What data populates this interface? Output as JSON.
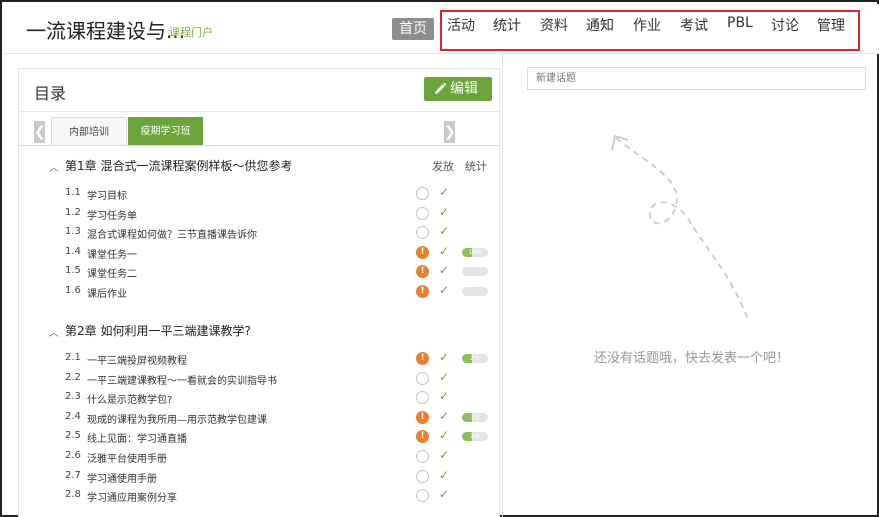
{
  "header": {
    "course_title": "一流课程建设与...",
    "portal_link": "课程门户",
    "home_label": "首页",
    "nav": [
      "活动",
      "统计",
      "资料",
      "通知",
      "作业",
      "考试",
      "PBL",
      "讨论",
      "管理"
    ]
  },
  "toc": {
    "title": "目录",
    "edit_label": "编辑",
    "prev_arrow": "❮",
    "next_arrow": "❯",
    "tabs": [
      "内部培训",
      "疫期学习班"
    ],
    "active_tab": "疫期学习班",
    "col_publish": "发放",
    "col_stats": "统计",
    "chapters": [
      {
        "title": "第1章 混合式一流课程案例样板～供您参考",
        "lessons": [
          {
            "num": "1.1",
            "name": "学习目标",
            "alert": false,
            "progress": null,
            "progress_label": ""
          },
          {
            "num": "1.2",
            "name": "学习任务单",
            "alert": false,
            "progress": null,
            "progress_label": ""
          },
          {
            "num": "1.3",
            "name": "混合式课程如何做？三节直播课告诉你",
            "alert": false,
            "progress": null,
            "progress_label": ""
          },
          {
            "num": "1.4",
            "name": "课堂任务一",
            "alert": true,
            "progress": 0.1,
            "progress_label": "10%"
          },
          {
            "num": "1.5",
            "name": "课堂任务二",
            "alert": true,
            "progress": 0,
            "progress_label": ""
          },
          {
            "num": "1.6",
            "name": "课后作业",
            "alert": true,
            "progress": 0,
            "progress_label": ""
          }
        ]
      },
      {
        "title": "第2章 如何利用一平三端建课教学?",
        "lessons": [
          {
            "num": "2.1",
            "name": "一平三端投屏视频教程",
            "alert": true,
            "progress": 0.02,
            "progress_label": "2%"
          },
          {
            "num": "2.2",
            "name": "一平三端建课教程～一看就会的实训指导书",
            "alert": false,
            "progress": null,
            "progress_label": ""
          },
          {
            "num": "2.3",
            "name": "什么是示范教学包?",
            "alert": false,
            "progress": null,
            "progress_label": ""
          },
          {
            "num": "2.4",
            "name": "现成的课程为我所用—用示范教学包建课",
            "alert": true,
            "progress": 0.01,
            "progress_label": "1%"
          },
          {
            "num": "2.5",
            "name": "线上见面：学习通直播",
            "alert": true,
            "progress": 0.02,
            "progress_label": "2%"
          },
          {
            "num": "2.6",
            "name": "泛雅平台使用手册",
            "alert": false,
            "progress": null,
            "progress_label": ""
          },
          {
            "num": "2.7",
            "name": "学习通使用手册",
            "alert": false,
            "progress": null,
            "progress_label": ""
          },
          {
            "num": "2.8",
            "name": "学习通应用案例分享",
            "alert": false,
            "progress": null,
            "progress_label": ""
          }
        ]
      }
    ]
  },
  "discussion": {
    "new_topic_placeholder": "新建话题",
    "empty_message": "还没有话题哦，快去发表一个吧！"
  },
  "colors": {
    "accent_green": "#6aa43a",
    "alert_orange": "#f07d2e",
    "nav_highlight_red": "#e0242a",
    "home_bg": "#8d8d8d"
  },
  "icons": {
    "edit": "pencil-icon",
    "chapter_toggle": "chevron-up-icon",
    "publish_done": "check-icon",
    "alert": "exclamation-icon",
    "empty_state": "dashed-arrow-icon"
  }
}
